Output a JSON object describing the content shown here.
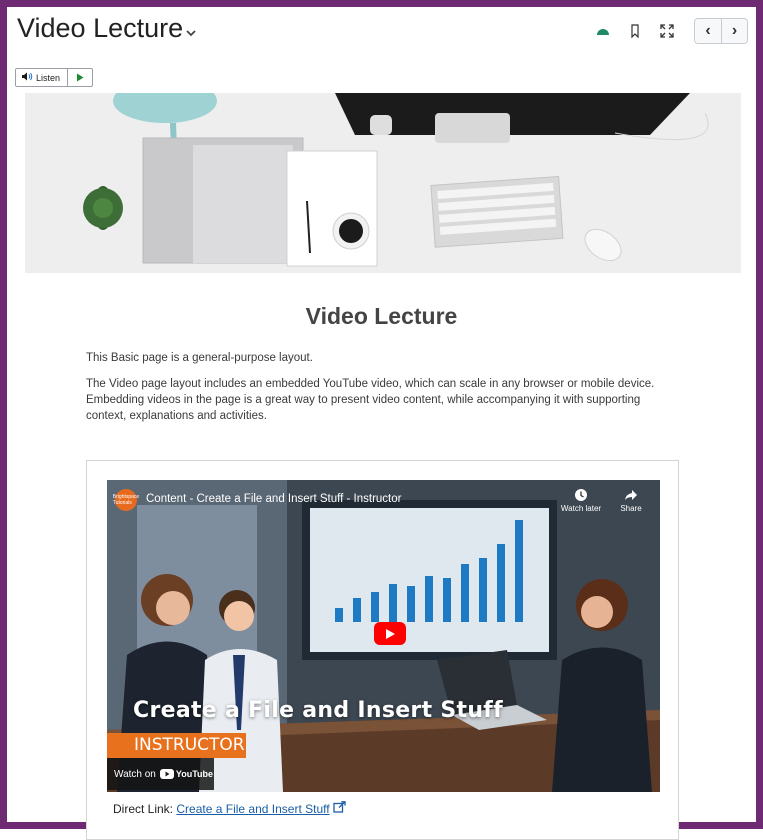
{
  "header": {
    "title": "Video Lecture",
    "title_menu_icon": "chevron-down-icon",
    "icons": [
      "reading-glasses-icon",
      "bookmark-icon",
      "fullscreen-icon"
    ],
    "prev_label": "‹",
    "next_label": "›"
  },
  "readspeaker": {
    "listen_label": "Listen",
    "play_icon": "play-icon"
  },
  "content": {
    "heading": "Video Lecture",
    "paragraph1": "This Basic page is a general-purpose layout.",
    "paragraph2": "The Video page layout includes an embedded YouTube video, which can scale in any browser or mobile device. Embedding videos in the page is a great way to present video content, while accompanying it with supporting context, explanations and activities."
  },
  "video": {
    "title": "Content - Create a File and Insert Stuff - Instructor",
    "channel_avatar_text": "Brightspace Tutorials",
    "watch_later_label": "Watch later",
    "share_label": "Share",
    "caption": "Create a File and Insert Stuff",
    "banner": "INSTRUCTOR",
    "watch_on_label": "Watch on",
    "youtube_label": "YouTube"
  },
  "direct_link": {
    "prefix": "Direct Link:",
    "link_text": "Create a File and Insert Stuff"
  },
  "colors": {
    "frame": "#6e2b73",
    "link": "#1a5ea8",
    "banner": "#e8711e",
    "play": "#ff0000"
  }
}
